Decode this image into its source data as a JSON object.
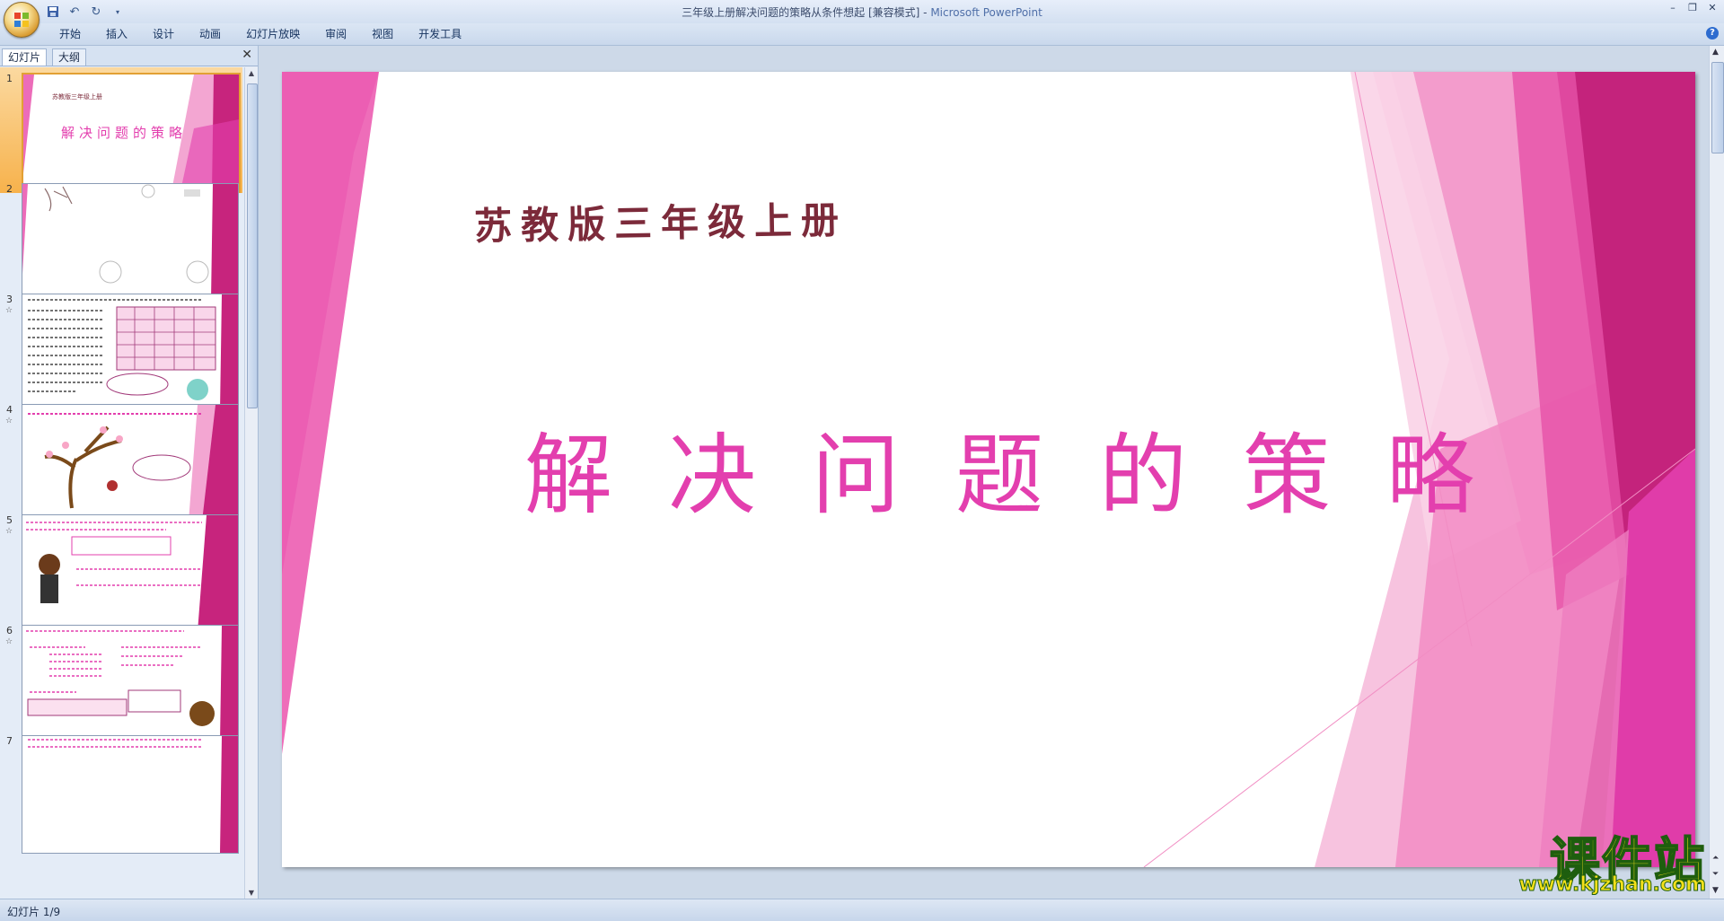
{
  "window": {
    "title": "三年级上册解决问题的策略从条件想起 [兼容模式] - ",
    "app_name": "Microsoft PowerPoint",
    "controls": [
      "–",
      "❐",
      "✕"
    ]
  },
  "quick_access": {
    "save_label": "save",
    "undo_label": "undo",
    "redo_label": "redo"
  },
  "ribbon": {
    "tabs": [
      "开始",
      "插入",
      "设计",
      "动画",
      "幻灯片放映",
      "审阅",
      "视图",
      "开发工具"
    ],
    "help": "?"
  },
  "panel": {
    "tabs": [
      "幻灯片",
      "大纲"
    ],
    "close": "✕"
  },
  "thumbnails": [
    {
      "num": "1",
      "selected": true
    },
    {
      "num": "2"
    },
    {
      "num": "3",
      "anim": "☆"
    },
    {
      "num": "4",
      "anim": "☆"
    },
    {
      "num": "5",
      "anim": "☆"
    },
    {
      "num": "6",
      "anim": "☆"
    },
    {
      "num": "7"
    }
  ],
  "slide": {
    "subtitle": "苏教版三年级上册",
    "title": "解决问题的策略"
  },
  "watermark": {
    "line1": "课件站",
    "line2": "www.kjzhan.com"
  },
  "status": {
    "slide_counter": "幻灯片 1/9"
  },
  "colors": {
    "accent_pink": "#e33fae",
    "deep_pink": "#c4237c",
    "light_pink": "#f4a6d2",
    "subtitle_maroon": "#7c2a3a"
  }
}
